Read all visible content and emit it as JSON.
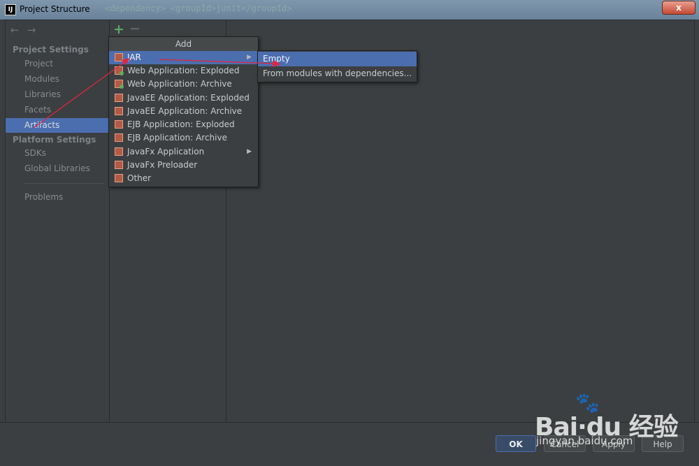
{
  "window": {
    "title": "Project Structure",
    "icon_label": "IJ",
    "background_code": "<dependency>  <groupId>junit</groupId>",
    "close_label": "x"
  },
  "sidebar": {
    "project_settings_header": "Project Settings",
    "project_items": [
      "Project",
      "Modules",
      "Libraries",
      "Facets",
      "Artifacts"
    ],
    "selected_item": "Artifacts",
    "platform_settings_header": "Platform Settings",
    "platform_items": [
      "SDKs",
      "Global Libraries"
    ],
    "problems": "Problems"
  },
  "toolbar": {
    "back_icon": "←",
    "forward_icon": "→",
    "add_icon": "+",
    "remove_icon": "−"
  },
  "add_menu": {
    "header": "Add",
    "items": [
      {
        "label": "JAR",
        "icon": "jar-icon",
        "has_submenu": true
      },
      {
        "label": "Web Application: Exploded",
        "icon": "web-icon"
      },
      {
        "label": "Web Application: Archive",
        "icon": "web-icon"
      },
      {
        "label": "JavaEE Application: Exploded",
        "icon": "jar-icon"
      },
      {
        "label": "JavaEE Application: Archive",
        "icon": "jar-icon"
      },
      {
        "label": "EJB Application: Exploded",
        "icon": "jar-icon"
      },
      {
        "label": "EJB Application: Archive",
        "icon": "jar-icon"
      },
      {
        "label": "JavaFx Application",
        "icon": "jar-icon",
        "has_submenu": true
      },
      {
        "label": "JavaFx Preloader",
        "icon": "jar-icon"
      },
      {
        "label": "Other",
        "icon": "jar-icon"
      }
    ],
    "submenu_arrow": "▶"
  },
  "jar_submenu": {
    "items": [
      "Empty",
      "From modules with dependencies..."
    ]
  },
  "buttons": {
    "ok": "OK",
    "cancel": "Cancel",
    "apply": "Apply",
    "help": "Help"
  },
  "watermark": {
    "brand": "Bai·du 经验",
    "url": "jingyan.baidu.com",
    "paw": "🐾"
  },
  "colors": {
    "background": "#3c3f41",
    "selection": "#4b6eaf",
    "annotation": "#e0263f"
  }
}
